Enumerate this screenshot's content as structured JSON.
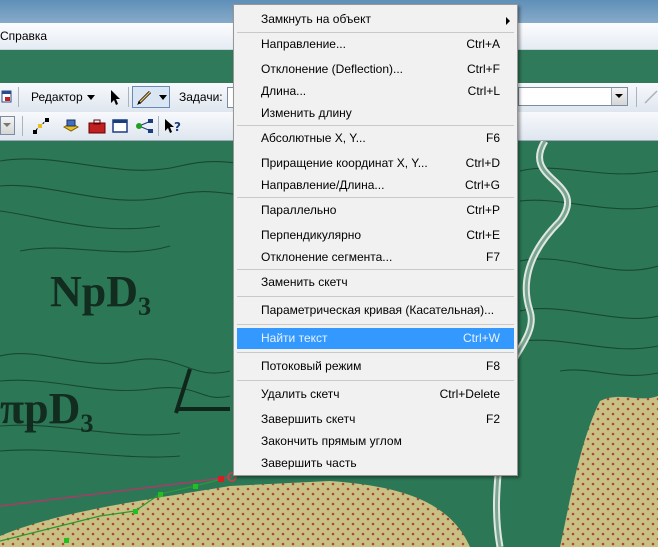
{
  "menubar": {
    "help_menu": "Справка"
  },
  "toolbar": {
    "editor_label": "Редактор",
    "tasks_label": "Задачи:"
  },
  "map": {
    "labels": {
      "top": "NpD₃",
      "bottom": "πpD₃"
    }
  },
  "context_menu": {
    "items": [
      {
        "label": "Замкнуть на объект",
        "shortcut": ""
      },
      {
        "label": "Направление...",
        "shortcut": "Ctrl+A"
      },
      {
        "label": "Отклонение (Deflection)...",
        "shortcut": "Ctrl+F"
      },
      {
        "label": "Длина...",
        "shortcut": "Ctrl+L"
      },
      {
        "label": "Изменить длину",
        "shortcut": ""
      },
      {
        "label": "Абсолютные X, Y...",
        "shortcut": "F6"
      },
      {
        "label": "Приращение координат X, Y...",
        "shortcut": "Ctrl+D"
      },
      {
        "label": "Направление/Длина...",
        "shortcut": "Ctrl+G"
      },
      {
        "label": "Параллельно",
        "shortcut": "Ctrl+P"
      },
      {
        "label": "Перпендикулярно",
        "shortcut": "Ctrl+E"
      },
      {
        "label": "Отклонение сегмента...",
        "shortcut": "F7"
      },
      {
        "label": "Заменить скетч",
        "shortcut": ""
      },
      {
        "label": "Параметрическая кривая (Касательная)...",
        "shortcut": ""
      },
      {
        "label": "Найти текст",
        "shortcut": "Ctrl+W"
      },
      {
        "label": "Потоковый режим",
        "shortcut": "F8"
      },
      {
        "label": "Удалить скетч",
        "shortcut": "Ctrl+Delete"
      },
      {
        "label": "Завершить скетч",
        "shortcut": "F2"
      },
      {
        "label": "Закончить прямым углом",
        "shortcut": ""
      },
      {
        "label": "Завершить часть",
        "shortcut": ""
      }
    ]
  },
  "colors": {
    "highlight": "#3399ff",
    "map_green": "#2c7856",
    "sketch_line": "#c0306a"
  }
}
